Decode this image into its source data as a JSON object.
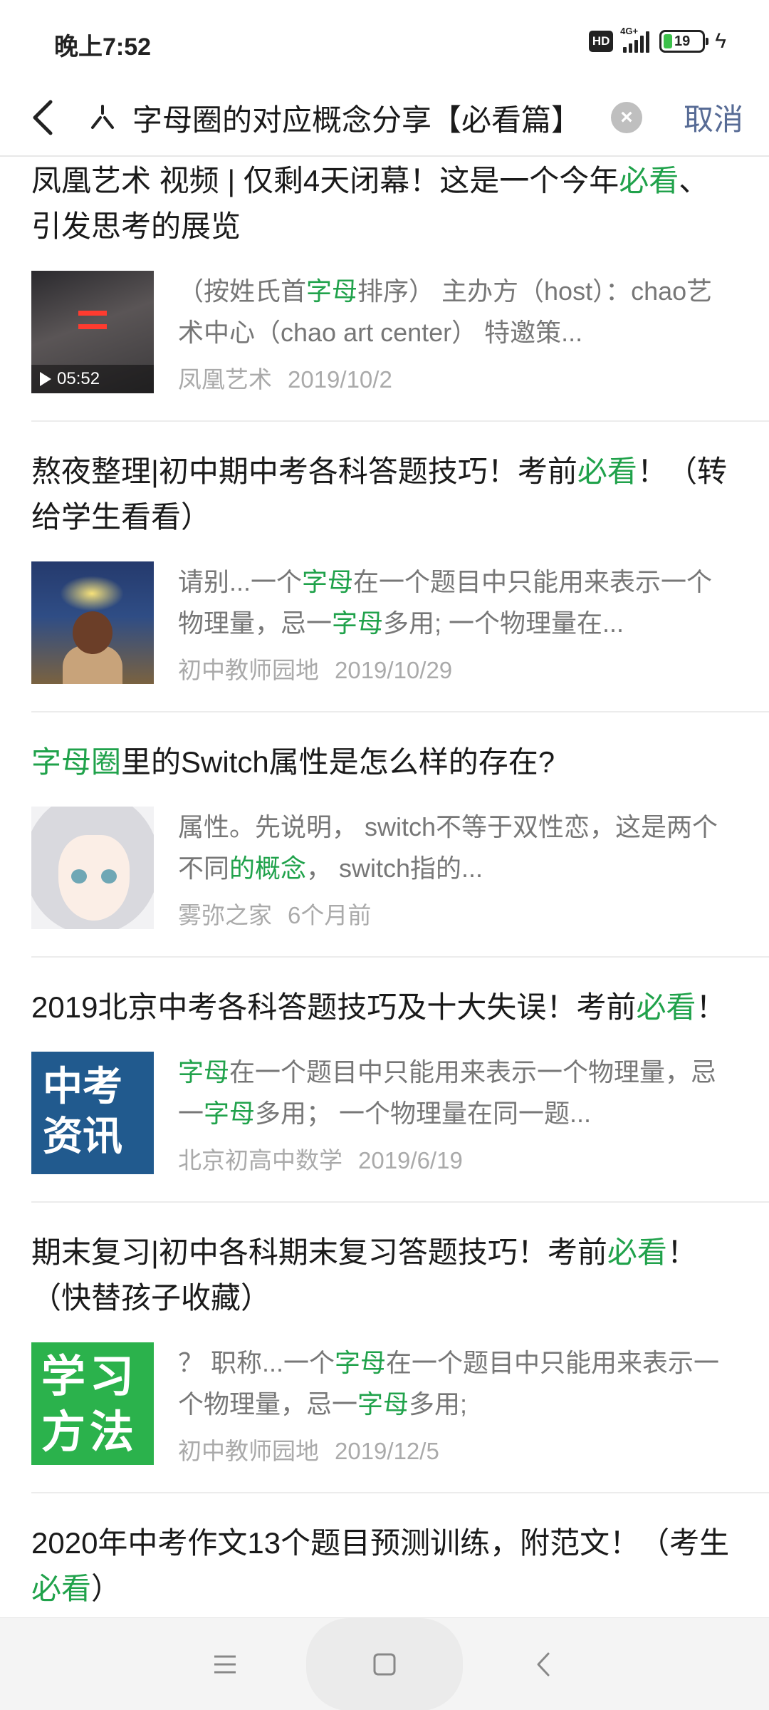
{
  "status_bar": {
    "time": "晚上7:52",
    "hd": "HD",
    "network": "4G+",
    "battery": "19"
  },
  "search": {
    "query": "字母圈的对应概念分享【必看篇】",
    "cancel_label": "取消"
  },
  "results": [
    {
      "title_parts": [
        {
          "text": "凤凰艺术 视频 | 仅剩4天闭幕！这是一个今年",
          "hl": false
        },
        {
          "text": "必看",
          "hl": true
        },
        {
          "text": "、引发思考的展览",
          "hl": false
        }
      ],
      "snippet_parts": [
        {
          "text": "（按姓氏首",
          "hl": false
        },
        {
          "text": "字母",
          "hl": true
        },
        {
          "text": "排序） 主办方（host）：chao艺术中心（chao art center） 特邀策...",
          "hl": false
        }
      ],
      "source": "凤凰艺术",
      "date": "2019/10/2",
      "thumb": "video",
      "duration": "05:52"
    },
    {
      "title_parts": [
        {
          "text": "熬夜整理|初中期中考各科答题技巧！考前",
          "hl": false
        },
        {
          "text": "必看",
          "hl": true
        },
        {
          "text": "！（转给学生看看）",
          "hl": false
        }
      ],
      "snippet_parts": [
        {
          "text": "请别...一个",
          "hl": false
        },
        {
          "text": "字母",
          "hl": true
        },
        {
          "text": "在一个题目中只能用来表示一个物理量，忌一",
          "hl": false
        },
        {
          "text": "字母",
          "hl": true
        },
        {
          "text": "多用; 一个物理量在...",
          "hl": false
        }
      ],
      "source": "初中教师园地",
      "date": "2019/10/29",
      "thumb": "study"
    },
    {
      "title_parts": [
        {
          "text": "字母圈",
          "hl": true
        },
        {
          "text": "里的Switch属性是怎么样的存在?",
          "hl": false
        }
      ],
      "snippet_parts": [
        {
          "text": "属性。先说明， switch不等于双性恋，这是两个不同",
          "hl": false
        },
        {
          "text": "的概念",
          "hl": true
        },
        {
          "text": "， switch指的...",
          "hl": false
        }
      ],
      "source": "雾弥之家",
      "date": "6个月前",
      "thumb": "anime"
    },
    {
      "title_parts": [
        {
          "text": "2019北京中考各科答题技巧及十大失误！考前",
          "hl": false
        },
        {
          "text": "必看",
          "hl": true
        },
        {
          "text": "！",
          "hl": false
        }
      ],
      "snippet_parts": [
        {
          "text": "字母",
          "hl": true
        },
        {
          "text": "在一个题目中只能用来表示一个物理量，忌一",
          "hl": false
        },
        {
          "text": "字母",
          "hl": true
        },
        {
          "text": "多用； 一个物理量在同一题...",
          "hl": false
        }
      ],
      "source": "北京初高中数学",
      "date": "2019/6/19",
      "thumb": "news",
      "thumb_text": "中考资讯"
    },
    {
      "title_parts": [
        {
          "text": "期末复习|初中各科期末复习答题技巧！考前",
          "hl": false
        },
        {
          "text": "必看",
          "hl": true
        },
        {
          "text": "！（快替孩子收藏）",
          "hl": false
        }
      ],
      "snippet_parts": [
        {
          "text": "？ 职称...一个",
          "hl": false
        },
        {
          "text": "字母",
          "hl": true
        },
        {
          "text": "在一个题目中只能用来表示一个物理量，忌一",
          "hl": false
        },
        {
          "text": "字母",
          "hl": true
        },
        {
          "text": "多用;",
          "hl": false
        }
      ],
      "source": "初中教师园地",
      "date": "2019/12/5",
      "thumb": "method",
      "thumb_text": "学习方法"
    },
    {
      "title_parts": [
        {
          "text": "2020年中考作文13个题目预测训练，附范文！（考生",
          "hl": false
        },
        {
          "text": "必看",
          "hl": true
        },
        {
          "text": "）",
          "hl": false
        }
      ],
      "snippet_parts": [],
      "source": "",
      "date": "",
      "thumb": "none"
    }
  ],
  "colors": {
    "highlight": "#20a24b",
    "cancel": "#576b95",
    "meta": "#aaaaaa"
  }
}
